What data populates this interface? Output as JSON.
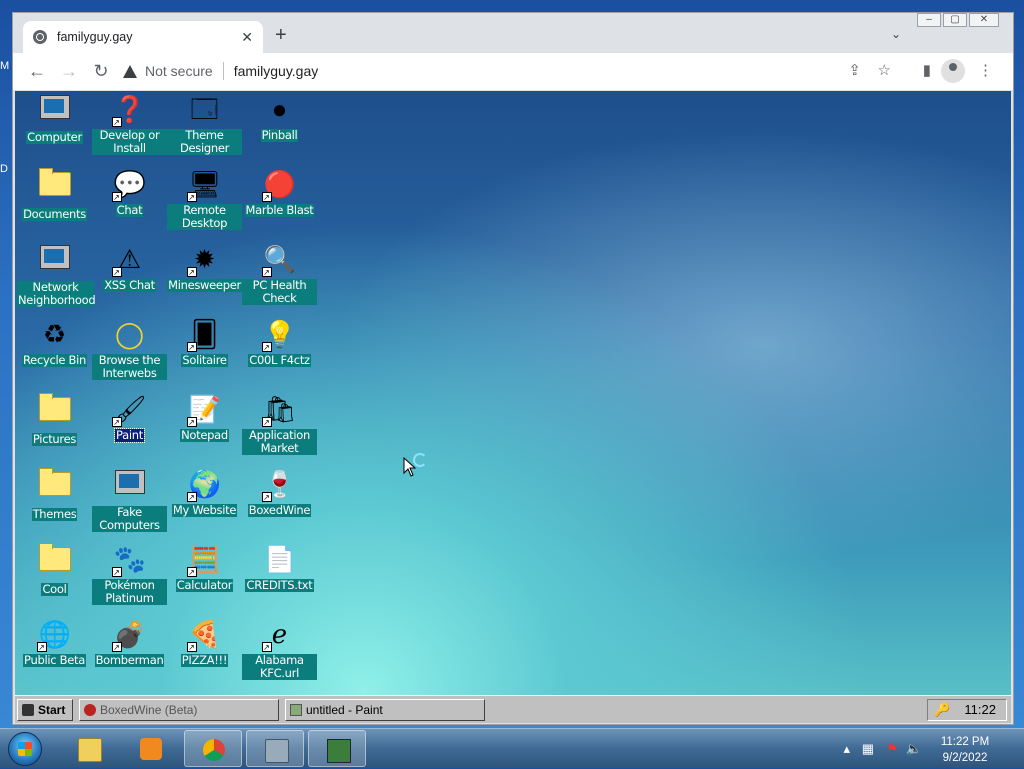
{
  "browser": {
    "tab_title": "familyguy.gay",
    "not_secure": "Not secure",
    "url": "familyguy.gay"
  },
  "desktop_icons": [
    {
      "label": "Computer"
    },
    {
      "label": "Develop or Install"
    },
    {
      "label": "Theme Designer"
    },
    {
      "label": "Pinball"
    },
    {
      "label": "Documents"
    },
    {
      "label": "Chat"
    },
    {
      "label": "Remote Desktop"
    },
    {
      "label": "Marble Blast"
    },
    {
      "label": "Network Neighborhood"
    },
    {
      "label": "XSS Chat"
    },
    {
      "label": "Minesweeper"
    },
    {
      "label": "PC Health Check"
    },
    {
      "label": "Recycle Bin"
    },
    {
      "label": "Browse the Interwebs"
    },
    {
      "label": "Solitaire"
    },
    {
      "label": "C00L F4ctz"
    },
    {
      "label": "Pictures"
    },
    {
      "label": "Paint"
    },
    {
      "label": "Notepad"
    },
    {
      "label": "Application Market"
    },
    {
      "label": "Themes"
    },
    {
      "label": "Fake Computers"
    },
    {
      "label": "My Website"
    },
    {
      "label": "BoxedWine"
    },
    {
      "label": "Cool"
    },
    {
      "label": "Pokémon Platinum"
    },
    {
      "label": "Calculator"
    },
    {
      "label": "CREDITS.txt"
    },
    {
      "label": "Public Beta"
    },
    {
      "label": "Bomberman"
    },
    {
      "label": "PIZZA!!!"
    },
    {
      "label": "Alabama KFC.url"
    }
  ],
  "taskbar98": {
    "start": "Start",
    "task1": "BoxedWine (Beta)",
    "task2": "untitled - Paint",
    "clock": "11:22"
  },
  "win7": {
    "time": "11:22 PM",
    "date": "9/2/2022"
  }
}
